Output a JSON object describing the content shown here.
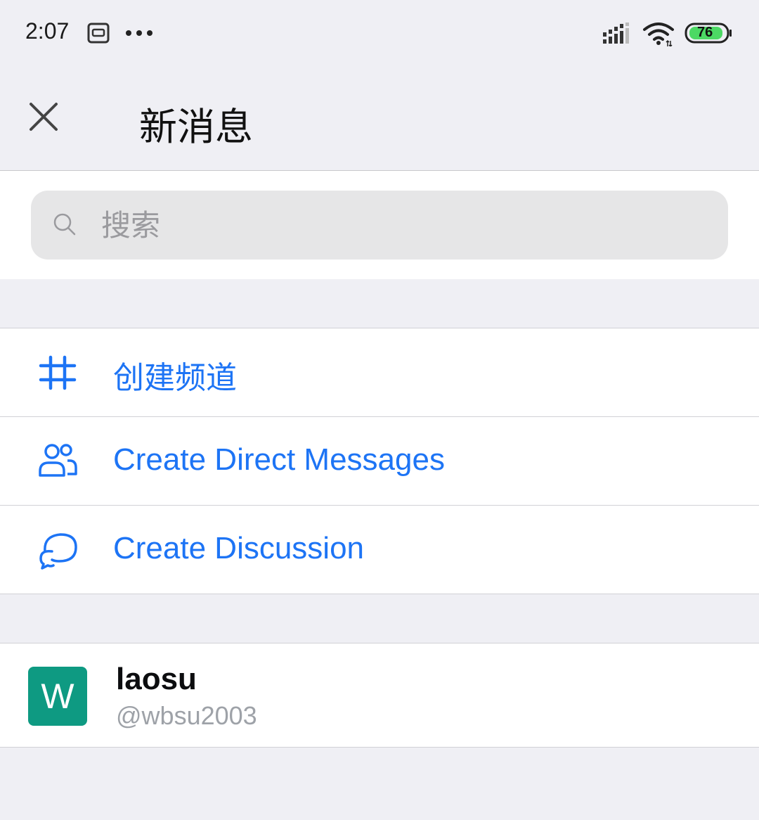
{
  "status_bar": {
    "time": "2:07",
    "battery": "76",
    "icons": [
      "sim-card-icon",
      "more-dots-icon",
      "signal-icon",
      "wifi-icon",
      "battery-icon"
    ]
  },
  "header": {
    "title": "新消息",
    "close_icon": "close-icon"
  },
  "search": {
    "placeholder": "搜索",
    "icon": "search-icon"
  },
  "actions": [
    {
      "label": "创建频道",
      "icon": "hash-icon"
    },
    {
      "label": "Create Direct Messages",
      "icon": "users-icon"
    },
    {
      "label": "Create Discussion",
      "icon": "discussion-icon"
    }
  ],
  "users": [
    {
      "name": "laosu",
      "handle": "@wbsu2003",
      "avatar_letter": "W",
      "avatar_color": "#0e9a82"
    }
  ],
  "colors": {
    "accent": "#1d74f5",
    "background": "#efeff4",
    "battery_fill": "#4cd964"
  }
}
